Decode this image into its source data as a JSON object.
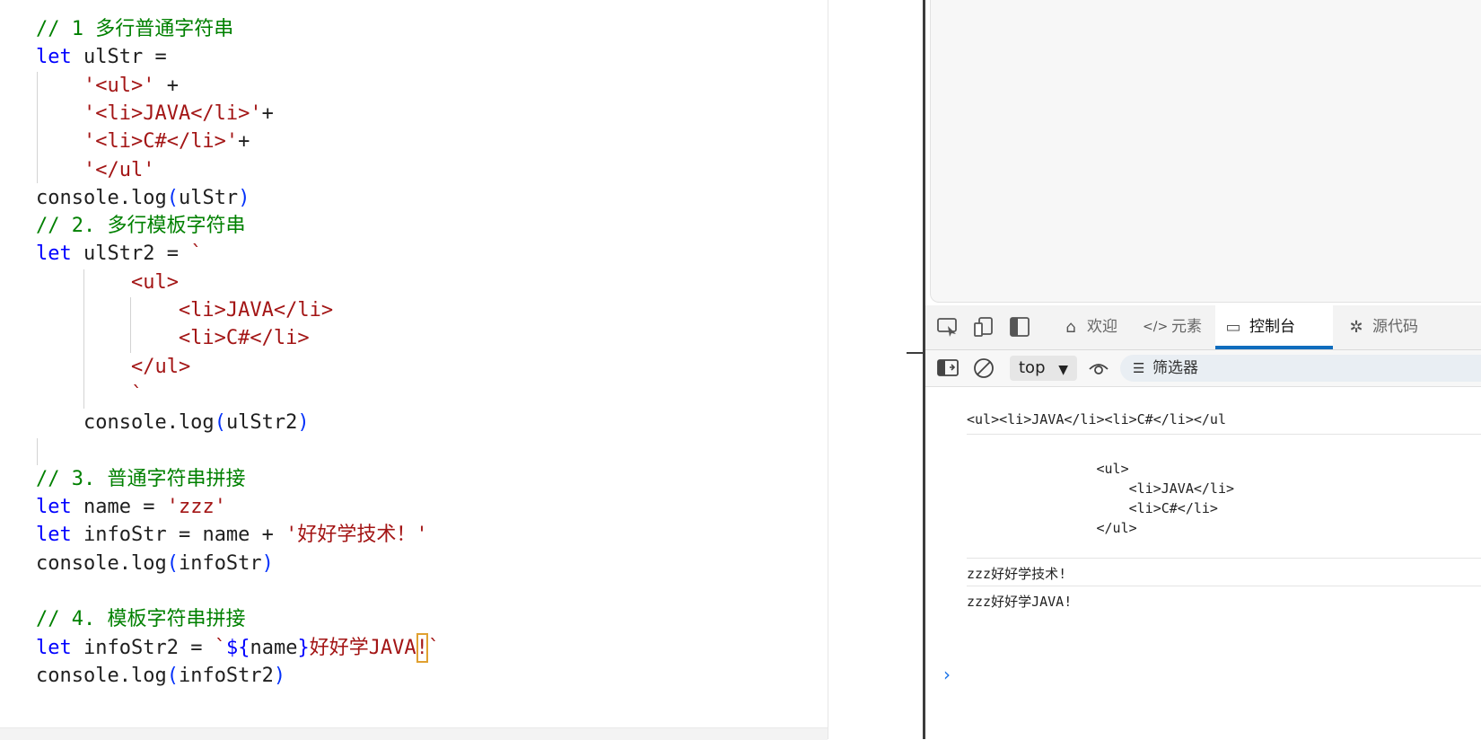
{
  "editor": {
    "lines": [
      [
        {
          "c": "cm",
          "t": "// 1 多行普通字符串"
        }
      ],
      [
        {
          "c": "kw",
          "t": "let"
        },
        {
          "c": "",
          "t": " ulStr ="
        }
      ],
      [
        {
          "c": "",
          "t": "    "
        },
        {
          "c": "st",
          "t": "'<ul>'"
        },
        {
          "c": "",
          "t": " +"
        }
      ],
      [
        {
          "c": "",
          "t": "    "
        },
        {
          "c": "st",
          "t": "'<li>JAVA</li>'"
        },
        {
          "c": "",
          "t": "+"
        }
      ],
      [
        {
          "c": "",
          "t": "    "
        },
        {
          "c": "st",
          "t": "'<li>C#</li>'"
        },
        {
          "c": "",
          "t": "+"
        }
      ],
      [
        {
          "c": "",
          "t": "    "
        },
        {
          "c": "st",
          "t": "'</ul'"
        }
      ],
      [
        {
          "c": "",
          "t": "console.log"
        },
        {
          "c": "pn",
          "t": "("
        },
        {
          "c": "",
          "t": "ulStr"
        },
        {
          "c": "pn",
          "t": ")"
        }
      ],
      [
        {
          "c": "cm",
          "t": "// 2. 多行模板字符串"
        }
      ],
      [
        {
          "c": "kw",
          "t": "let"
        },
        {
          "c": "",
          "t": " ulStr2 = "
        },
        {
          "c": "st",
          "t": "`"
        }
      ],
      [
        {
          "c": "st",
          "t": "        <ul>"
        }
      ],
      [
        {
          "c": "st",
          "t": "            <li>JAVA</li>"
        }
      ],
      [
        {
          "c": "st",
          "t": "            <li>C#</li>"
        }
      ],
      [
        {
          "c": "st",
          "t": "        </ul>"
        }
      ],
      [
        {
          "c": "st",
          "t": "        `"
        }
      ],
      [
        {
          "c": "",
          "t": "    console.log"
        },
        {
          "c": "pn",
          "t": "("
        },
        {
          "c": "",
          "t": "ulStr2"
        },
        {
          "c": "pn",
          "t": ")"
        }
      ],
      [
        {
          "c": "",
          "t": ""
        }
      ],
      [
        {
          "c": "cm",
          "t": "// 3. 普通字符串拼接"
        }
      ],
      [
        {
          "c": "kw",
          "t": "let"
        },
        {
          "c": "",
          "t": " name = "
        },
        {
          "c": "st",
          "t": "'zzz'"
        }
      ],
      [
        {
          "c": "kw",
          "t": "let"
        },
        {
          "c": "",
          "t": " infoStr = name + "
        },
        {
          "c": "st",
          "t": "'好好学技术！'"
        }
      ],
      [
        {
          "c": "",
          "t": "console.log"
        },
        {
          "c": "pn",
          "t": "("
        },
        {
          "c": "",
          "t": "infoStr"
        },
        {
          "c": "pn",
          "t": ")"
        }
      ],
      [
        {
          "c": "",
          "t": ""
        }
      ],
      [
        {
          "c": "cm",
          "t": "// 4. 模板字符串拼接"
        }
      ],
      [
        {
          "c": "kw",
          "t": "let"
        },
        {
          "c": "",
          "t": " infoStr2 = "
        },
        {
          "c": "st",
          "t": "`"
        },
        {
          "c": "kw",
          "t": "${"
        },
        {
          "c": "",
          "t": "name"
        },
        {
          "c": "kw",
          "t": "}"
        },
        {
          "c": "st",
          "t": "好好学JAVA"
        },
        {
          "c": "st cursor",
          "t": "!"
        },
        {
          "c": "st",
          "t": "`"
        }
      ],
      [
        {
          "c": "",
          "t": "console.log"
        },
        {
          "c": "pn",
          "t": "("
        },
        {
          "c": "",
          "t": "infoStr2"
        },
        {
          "c": "pn",
          "t": ")"
        }
      ]
    ]
  },
  "devtools": {
    "toolbar_icons": [
      "inspect-icon",
      "device-emulation-icon",
      "dock-side-icon"
    ],
    "tabs": [
      {
        "label": "欢迎",
        "icon": "home-icon"
      },
      {
        "label": "元素",
        "icon": "code-icon"
      },
      {
        "label": "控制台",
        "icon": "console-icon"
      },
      {
        "label": "源代码",
        "icon": "bug-icon"
      }
    ],
    "active_tab": "控制台",
    "context": "top",
    "filter_label": "筛选器",
    "console": {
      "messages": [
        "<ul><li>JAVA</li><li>C#</li></ul",
        "\n                <ul>\n                    <li>JAVA</li>\n                    <li>C#</li>\n                </ul>\n                ",
        "zzz好好学技术!",
        "zzz好好学JAVA!"
      ],
      "prompt": "›"
    },
    "accent_color": "#0f6cbd"
  }
}
